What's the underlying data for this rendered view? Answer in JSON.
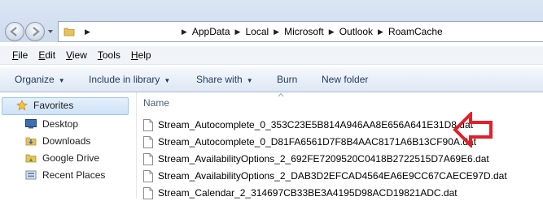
{
  "breadcrumbs": [
    "AppData",
    "Local",
    "Microsoft",
    "Outlook",
    "RoamCache"
  ],
  "menu": {
    "file": {
      "acc": "F",
      "rest": "ile"
    },
    "edit": {
      "acc": "E",
      "rest": "dit"
    },
    "view": {
      "acc": "V",
      "rest": "iew"
    },
    "tools": {
      "acc": "T",
      "rest": "ools"
    },
    "help": {
      "acc": "H",
      "rest": "elp"
    }
  },
  "toolbar": {
    "organize": "Organize",
    "include": "Include in library",
    "share": "Share with",
    "burn": "Burn",
    "new_folder": "New folder"
  },
  "sidebar": {
    "favorites": "Favorites",
    "items": [
      "Desktop",
      "Downloads",
      "Google Drive",
      "Recent Places"
    ]
  },
  "list": {
    "column_name": "Name",
    "files": [
      "Stream_Autocomplete_0_353C23E5B814A946AA8E656A641E31D8.dat",
      "Stream_Autocomplete_0_D81FA6561D7F8B4AAC8171A6B13CF90A.dat",
      "Stream_AvailabilityOptions_2_692FE7209520C0418B2722515D7A69E6.dat",
      "Stream_AvailabilityOptions_2_DAB3D2EFCAD4564EA6E9CC67CAECE97D.dat",
      "Stream_Calendar_2_314697CB33BE3A4195D98ACD19821ADC.dat"
    ]
  },
  "colors": {
    "annotation_arrow": "#e0202a",
    "accent": "#1e395b"
  }
}
